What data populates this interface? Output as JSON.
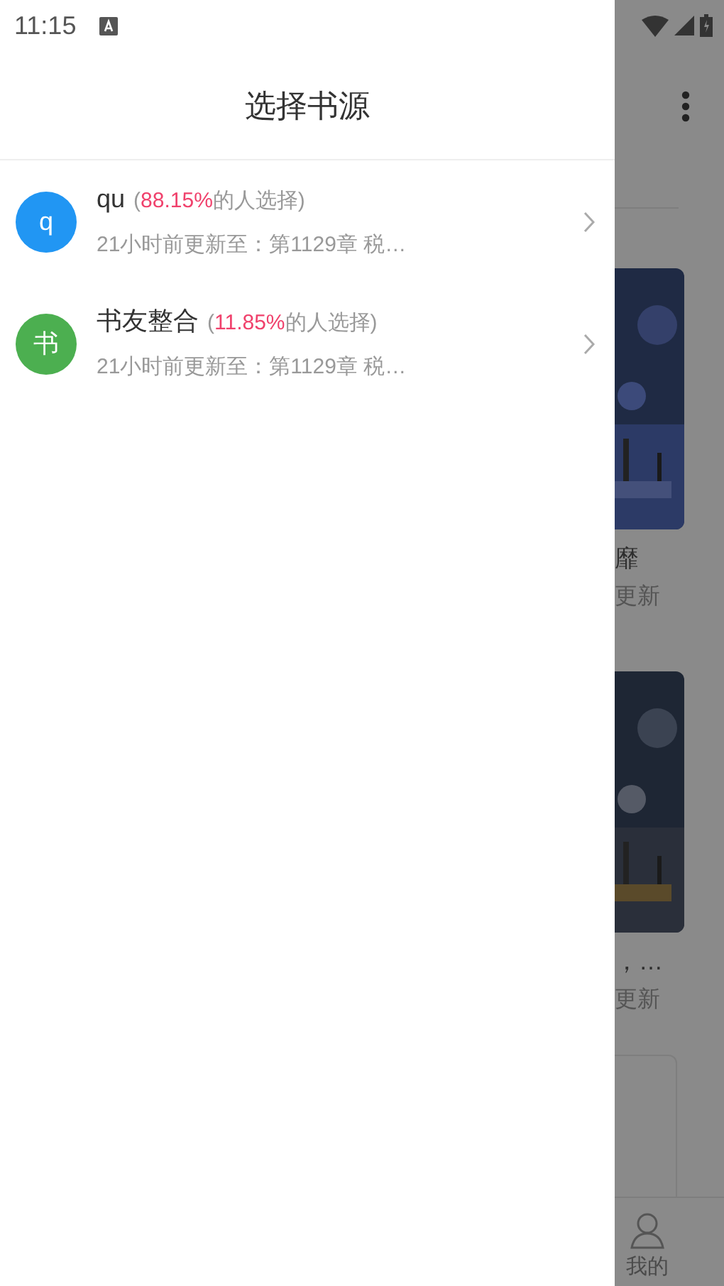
{
  "status_bar": {
    "time": "11:15"
  },
  "drawer": {
    "title": "选择书源",
    "sources": [
      {
        "avatar": "q",
        "color": "#2196f3",
        "name": "qu",
        "open": "(",
        "share": "88.15%",
        "close": "的人选择)",
        "update": "21小时前更新至：第1129章 税…"
      },
      {
        "avatar": "书",
        "color": "#4caf50",
        "name": "书友整合",
        "open": "(",
        "share": "11.85%",
        "close": "的人选择)",
        "update": "21小时前更新至：第1129章 税…"
      }
    ]
  },
  "background": {
    "books": [
      {
        "kind": "picture",
        "title": "靡",
        "status": "更新"
      },
      {
        "kind": "picture",
        "title": "，…",
        "status": "更新"
      }
    ],
    "nav": [
      {
        "label": "我的"
      }
    ]
  }
}
